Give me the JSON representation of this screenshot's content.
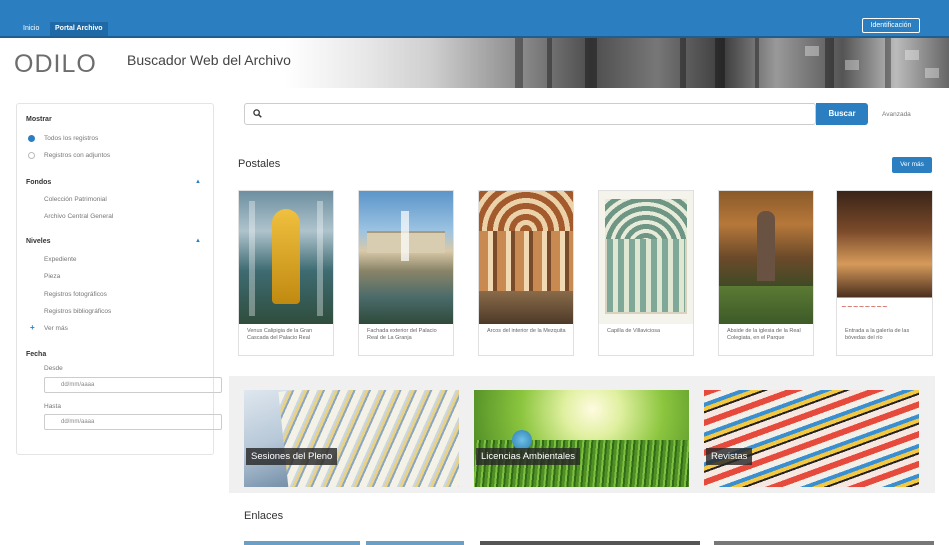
{
  "topbar": {
    "home_label": "Inicio",
    "portal_label": "Portal Archivo",
    "login_label": "Identificación"
  },
  "header": {
    "logo": "ODILO",
    "logo_sub": "",
    "title": "Buscador Web del Archivo"
  },
  "sidebar": {
    "mostrar": {
      "heading": "Mostrar",
      "options": [
        "Todos los registros",
        "Registros con adjuntos"
      ],
      "selected": 0
    },
    "fondos": {
      "heading": "Fondos",
      "items": [
        "Colección Patrimonial",
        "Archivo Central General"
      ]
    },
    "niveles": {
      "heading": "Niveles",
      "items": [
        "Expediente",
        "Pieza",
        "Registros fotográficos",
        "Registros bibliográficos"
      ],
      "more_label": "Ver más"
    },
    "fecha": {
      "heading": "Fecha",
      "from_label": "Desde",
      "from_placeholder": "dd/mm/aaaa",
      "to_label": "Hasta",
      "to_placeholder": "dd/mm/aaaa"
    }
  },
  "search": {
    "placeholder": "",
    "button_label": "Buscar",
    "advanced_label": "Avanzada"
  },
  "postales": {
    "title": "Postales",
    "more_label": "Ver más",
    "cards": [
      {
        "caption": "Venus Calipigia de la Gran Cascada del Palacio Real"
      },
      {
        "caption": "Fachada exterior del Palacio Real de La Granja"
      },
      {
        "caption": "Arcos del interior de la Mezquita"
      },
      {
        "caption": "Capilla de Villaviciosa"
      },
      {
        "caption": "Ábside de la iglesia de la Real Colegiata, en el Parque"
      },
      {
        "caption": "Entrada a la galería de las bóvedas del río"
      }
    ]
  },
  "tiles": [
    {
      "label": "Sesiones del Pleno"
    },
    {
      "label": "Licencias Ambientales"
    },
    {
      "label": "Revistas"
    }
  ],
  "enlaces": {
    "title": "Enlaces"
  },
  "colors": {
    "accent": "#2b7fc1",
    "topbar": "#2b7fc1"
  },
  "icons": [
    "search-icon",
    "chevron-up-icon",
    "plus-icon",
    "radio-icon"
  ]
}
